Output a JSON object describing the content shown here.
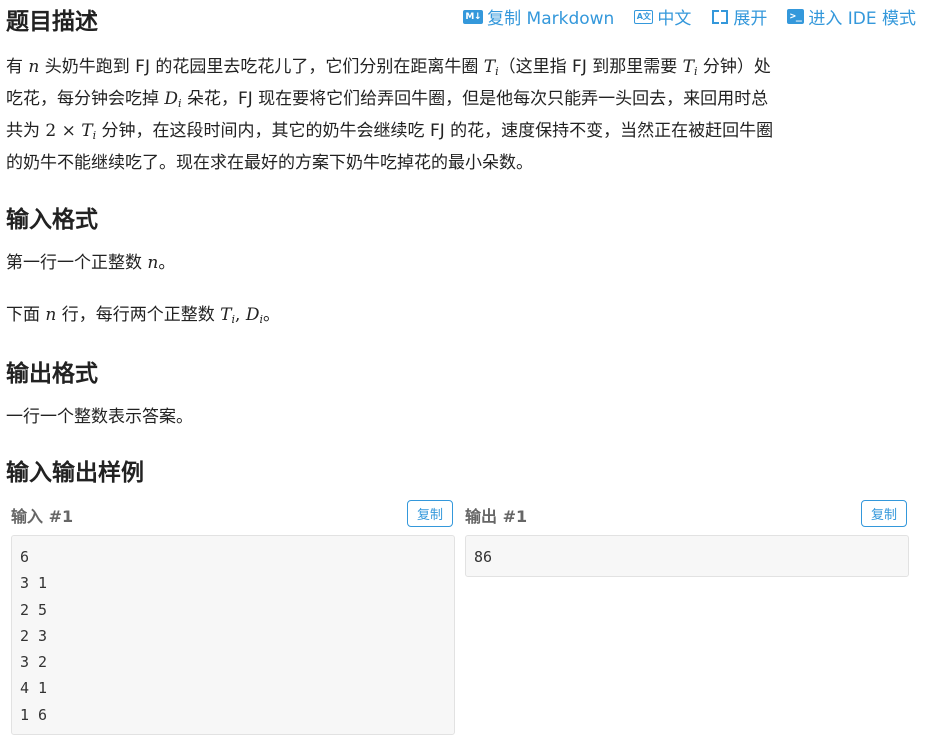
{
  "headings": {
    "description": "题目描述",
    "input_format": "输入格式",
    "output_format": "输出格式",
    "samples": "输入输出样例"
  },
  "toolbar": {
    "copy_markdown_icon": "M↓",
    "copy_markdown": "复制 Markdown",
    "lang_icon": "A文",
    "lang": "中文",
    "expand": "展开",
    "ide_icon": ">_",
    "ide": "进入 IDE 模式"
  },
  "description": {
    "l1_a": "有 ",
    "l1_b": " 头奶牛跑到 FJ 的花园里去吃花儿了，它们分别在距离牛圈 ",
    "l1_c": "（这里指 FJ 到那里需要 ",
    "l1_d": " 分钟）处",
    "l2_a": "吃花，每分钟会吃掉 ",
    "l2_b": " 朵花，FJ 现在要将它们给弄回牛圈，但是他每次只能弄一头回去，来回用时总",
    "l3_a": "共为 ",
    "l3_b": " 分钟，在这段时间内，其它的奶牛会继续吃 FJ 的花，速度保持不变，当然正在被赶回牛圈",
    "l4": "的奶牛不能继续吃了。现在求在最好的方案下奶牛吃掉花的最小朵数。"
  },
  "math": {
    "n": "n",
    "T": "T",
    "D": "D",
    "i": "i",
    "two_times": "2 × ",
    "comma": ", "
  },
  "input_format": {
    "line1": "第一行一个正整数 ",
    "line1_end": "。",
    "line2": "下面 ",
    "line2_mid": " 行，每行两个正整数 ",
    "line2_end": "。"
  },
  "output_format": {
    "line1": "一行一个整数表示答案。"
  },
  "samples": {
    "input_label": "输入 #1",
    "output_label": "输出 #1",
    "copy": "复制",
    "input_lines": [
      "6",
      "3 1",
      "2 5",
      "2 3",
      "3 2",
      "4 1",
      "1 6"
    ],
    "output_lines": [
      "86"
    ]
  },
  "colors": {
    "accent": "#3498db",
    "sample_bg": "#f7f7f7"
  }
}
